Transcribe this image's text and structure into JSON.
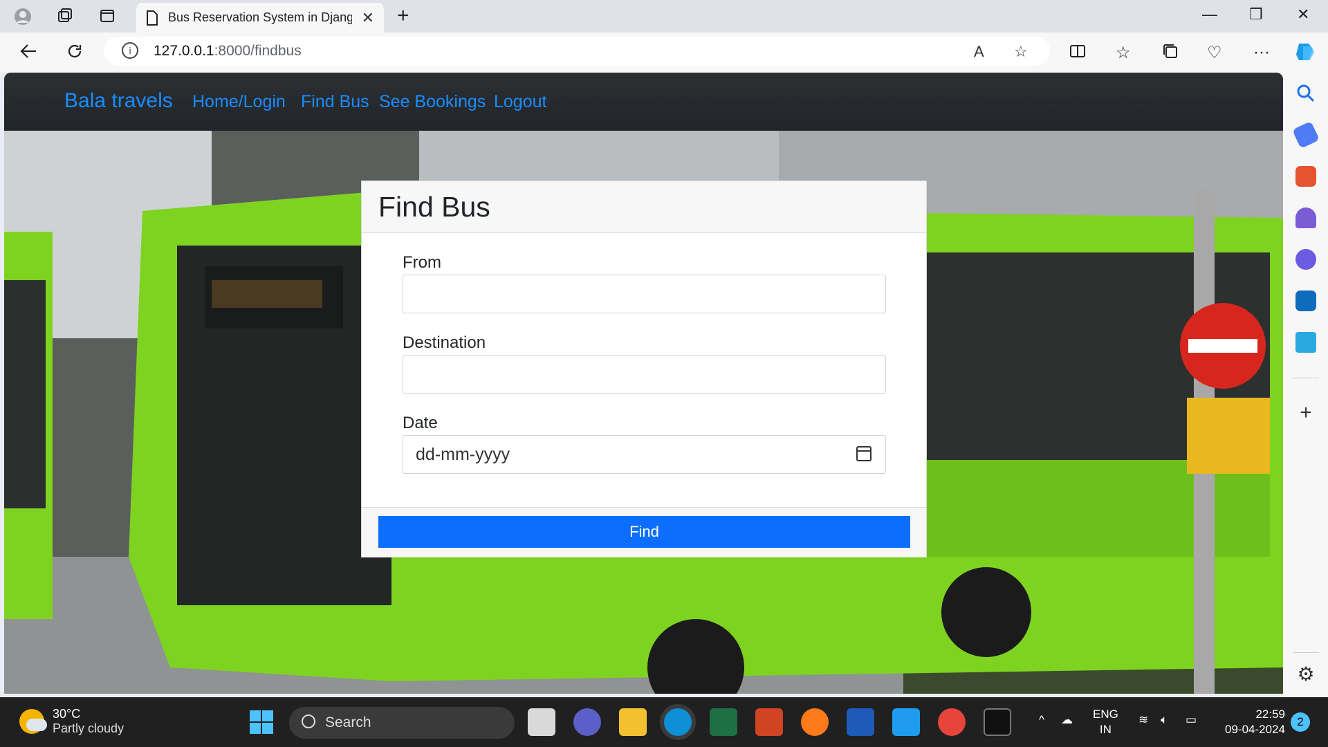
{
  "browser": {
    "tab_title": "Bus Reservation System in Django",
    "url_host": "127.0.0.1",
    "url_path": ":8000/findbus"
  },
  "navbar": {
    "brand": "Bala travels",
    "links": [
      "Home/Login",
      "Find Bus",
      "See Bookings",
      "Logout"
    ]
  },
  "card": {
    "title": "Find Bus",
    "fields": [
      {
        "label": "From",
        "value": ""
      },
      {
        "label": "Destination",
        "value": ""
      },
      {
        "label": "Date",
        "placeholder": "dd-mm-yyyy"
      }
    ],
    "button": "Find"
  },
  "taskbar": {
    "temperature": "30°C",
    "weather": "Partly cloudy",
    "search": "Search",
    "lang1": "ENG",
    "lang2": "IN",
    "time": "22:59",
    "date": "09-04-2024",
    "notifications": "2"
  },
  "colors": {
    "accent": "#0d6efd",
    "nav_link": "#1a8cff",
    "navbar_bg": "#212529",
    "bus_green": "#7ed321"
  }
}
